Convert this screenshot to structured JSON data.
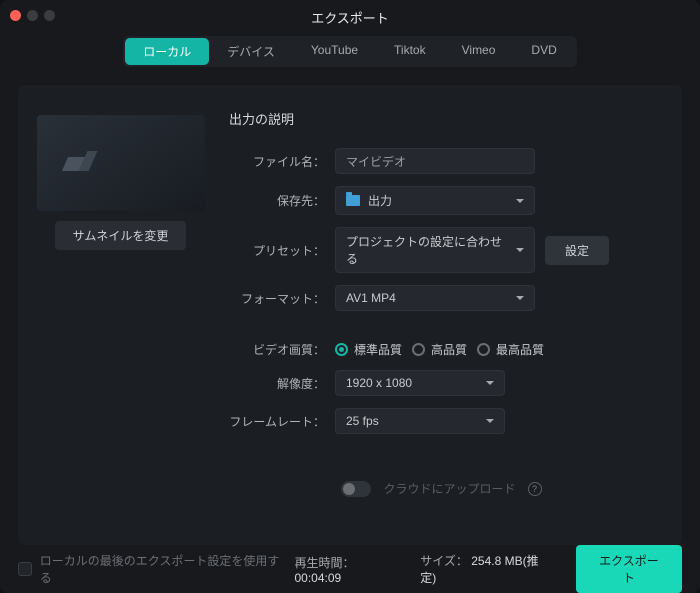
{
  "window": {
    "title": "エクスポート"
  },
  "tabs": {
    "t0": "ローカル",
    "t1": "デバイス",
    "t2": "YouTube",
    "t3": "Tiktok",
    "t4": "Vimeo",
    "t5": "DVD"
  },
  "left": {
    "thumb_btn": "サムネイルを変更"
  },
  "right": {
    "section": "出力の説明",
    "labels": {
      "filename": "ファイル名：",
      "saveto": "保存先：",
      "preset": "プリセット：",
      "format": "フォーマット：",
      "quality": "ビデオ画質：",
      "resolution": "解像度：",
      "framerate": "フレームレート："
    },
    "values": {
      "filename": "マイビデオ",
      "saveto": "出力",
      "preset": "プロジェクトの設定に合わせる",
      "format": "AV1 MP4",
      "resolution": "1920 x 1080",
      "framerate": "25 fps"
    },
    "settings_btn": "設定",
    "quality": {
      "std": "標準品質",
      "high": "高品質",
      "best": "最高品質"
    },
    "upload": "クラウドにアップロード"
  },
  "footer": {
    "remember": "ローカルの最後のエクスポート設定を使用する",
    "duration_lbl": "再生時間：",
    "duration_val": "00:04:09",
    "size_lbl": "サイズ：",
    "size_val": "254.8 MB(推定)",
    "export_btn": "エクスポート"
  }
}
